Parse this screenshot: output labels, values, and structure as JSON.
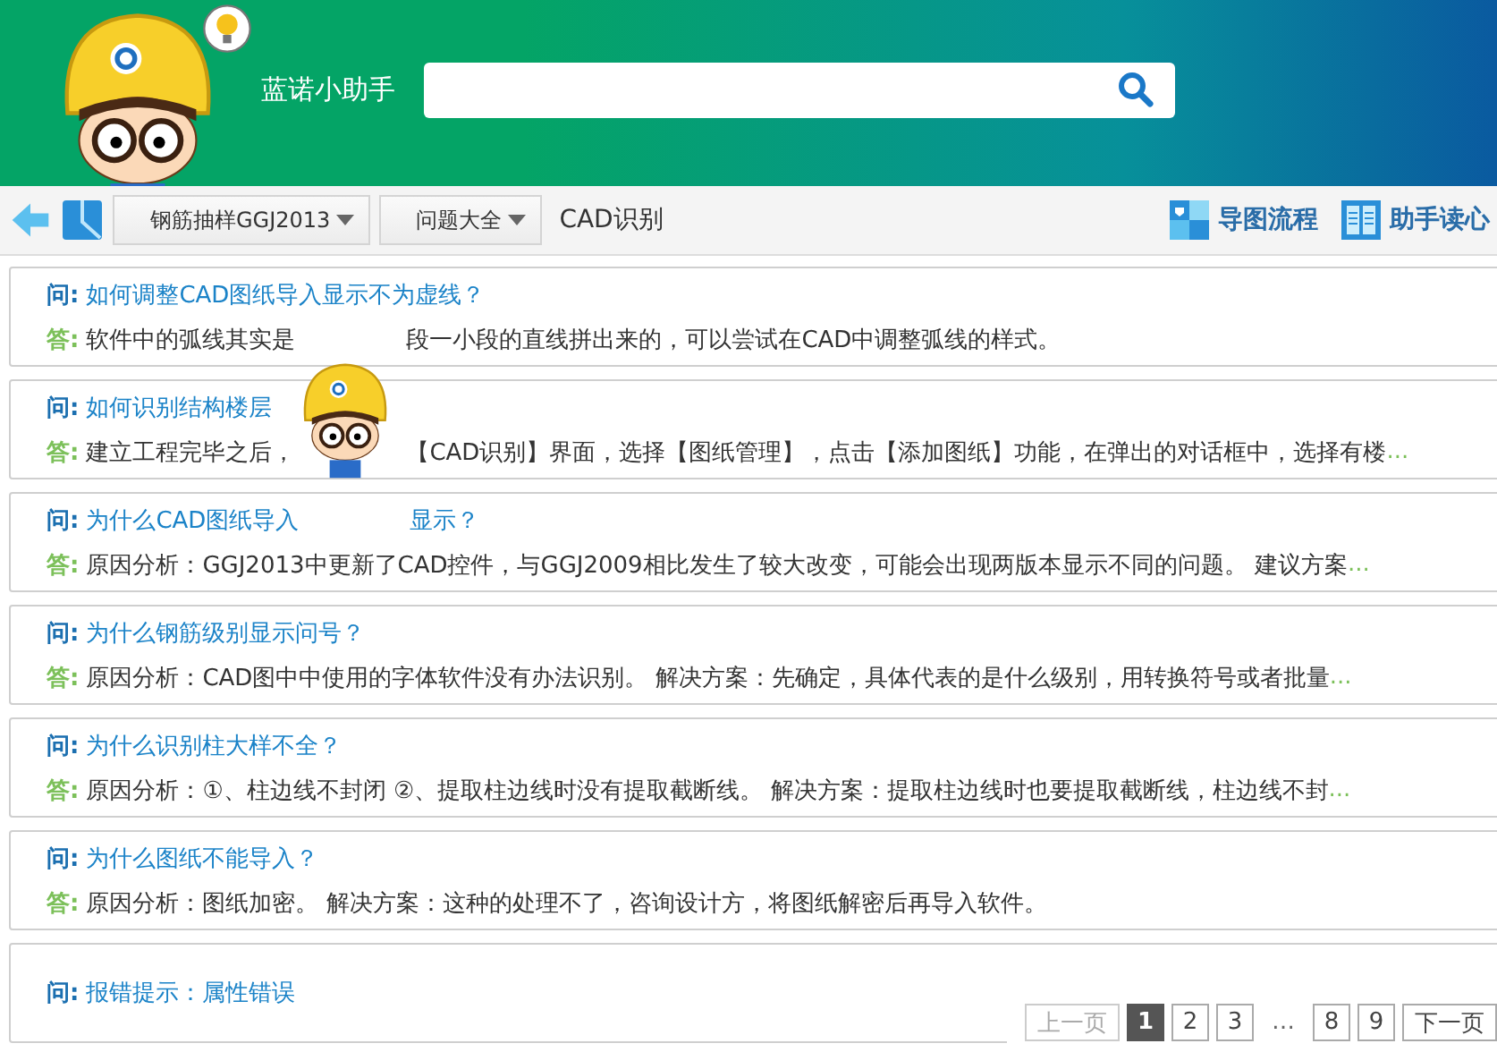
{
  "header": {
    "title": "蓝诺小助手",
    "search_field": true
  },
  "toolbar": {
    "dropdowns": [
      {
        "label": "钢筋抽样GGJ2013"
      },
      {
        "label": "问题大全"
      }
    ],
    "breadcrumb": "CAD识别",
    "actions": [
      {
        "kind": "flow",
        "label": "导图流程"
      },
      {
        "kind": "mind",
        "label": "助手读心"
      }
    ]
  },
  "qa_list": [
    {
      "q_label": "问:",
      "question": [
        "如何调整CAD图纸导入显示不为虚线？"
      ],
      "a_label": "答:",
      "answer": [
        "软件中的弧线其实是",
        "段一小段的直线拼出来的，可以尝试在CAD中调整弧线的样式。"
      ]
    },
    {
      "q_label": "问:",
      "question": [
        "如何识别结构楼层"
      ],
      "a_label": "答:",
      "answer": [
        "建立工程完毕之后，",
        "【CAD识别】界面，选择【图纸管理】，点击【添加图纸】功能，在弹出的对话框中，选择有楼"
      ],
      "more": "..."
    },
    {
      "q_label": "问:",
      "question": [
        "为什么CAD图纸导入",
        "显示？"
      ],
      "a_label": "答:",
      "answer": [
        "原因分析：GGJ2013中更新了CAD控件，与GGJ2009相比发生了较大改变，可能会出现两版本显示不同的问题。 建议方案"
      ],
      "more": "..."
    },
    {
      "q_label": "问:",
      "question": [
        "为什么钢筋级别显示问号？"
      ],
      "a_label": "答:",
      "answer": [
        "原因分析：CAD图中中使用的字体软件没有办法识别。 解决方案：先确定，具体代表的是什么级别，用转换符号或者批量"
      ],
      "more": "..."
    },
    {
      "q_label": "问:",
      "question": [
        "为什么识别柱大样不全？"
      ],
      "a_label": "答:",
      "answer": [
        "原因分析：①、柱边线不封闭 ②、提取柱边线时没有提取截断线。 解决方案：提取柱边线时也要提取截断线，柱边线不封"
      ],
      "more": "..."
    },
    {
      "q_label": "问:",
      "question": [
        "为什么图纸不能导入？"
      ],
      "a_label": "答:",
      "answer": [
        "原因分析：图纸加密。 解决方案：这种的处理不了，咨询设计方，将图纸解密后再导入软件。"
      ]
    },
    {
      "q_label": "问:",
      "question": [
        "报错提示：属性错误"
      ]
    }
  ],
  "pagination": {
    "prev": {
      "label": "上一页",
      "disabled": true
    },
    "pages": [
      {
        "label": "1",
        "selected": true
      },
      {
        "label": "2",
        "selected": false
      },
      {
        "label": "3",
        "selected": false
      },
      {
        "kind": "gap",
        "label": "…"
      },
      {
        "label": "8",
        "selected": false
      },
      {
        "label": "9",
        "selected": false
      }
    ],
    "next": {
      "label": "下一页",
      "disabled": false
    }
  }
}
